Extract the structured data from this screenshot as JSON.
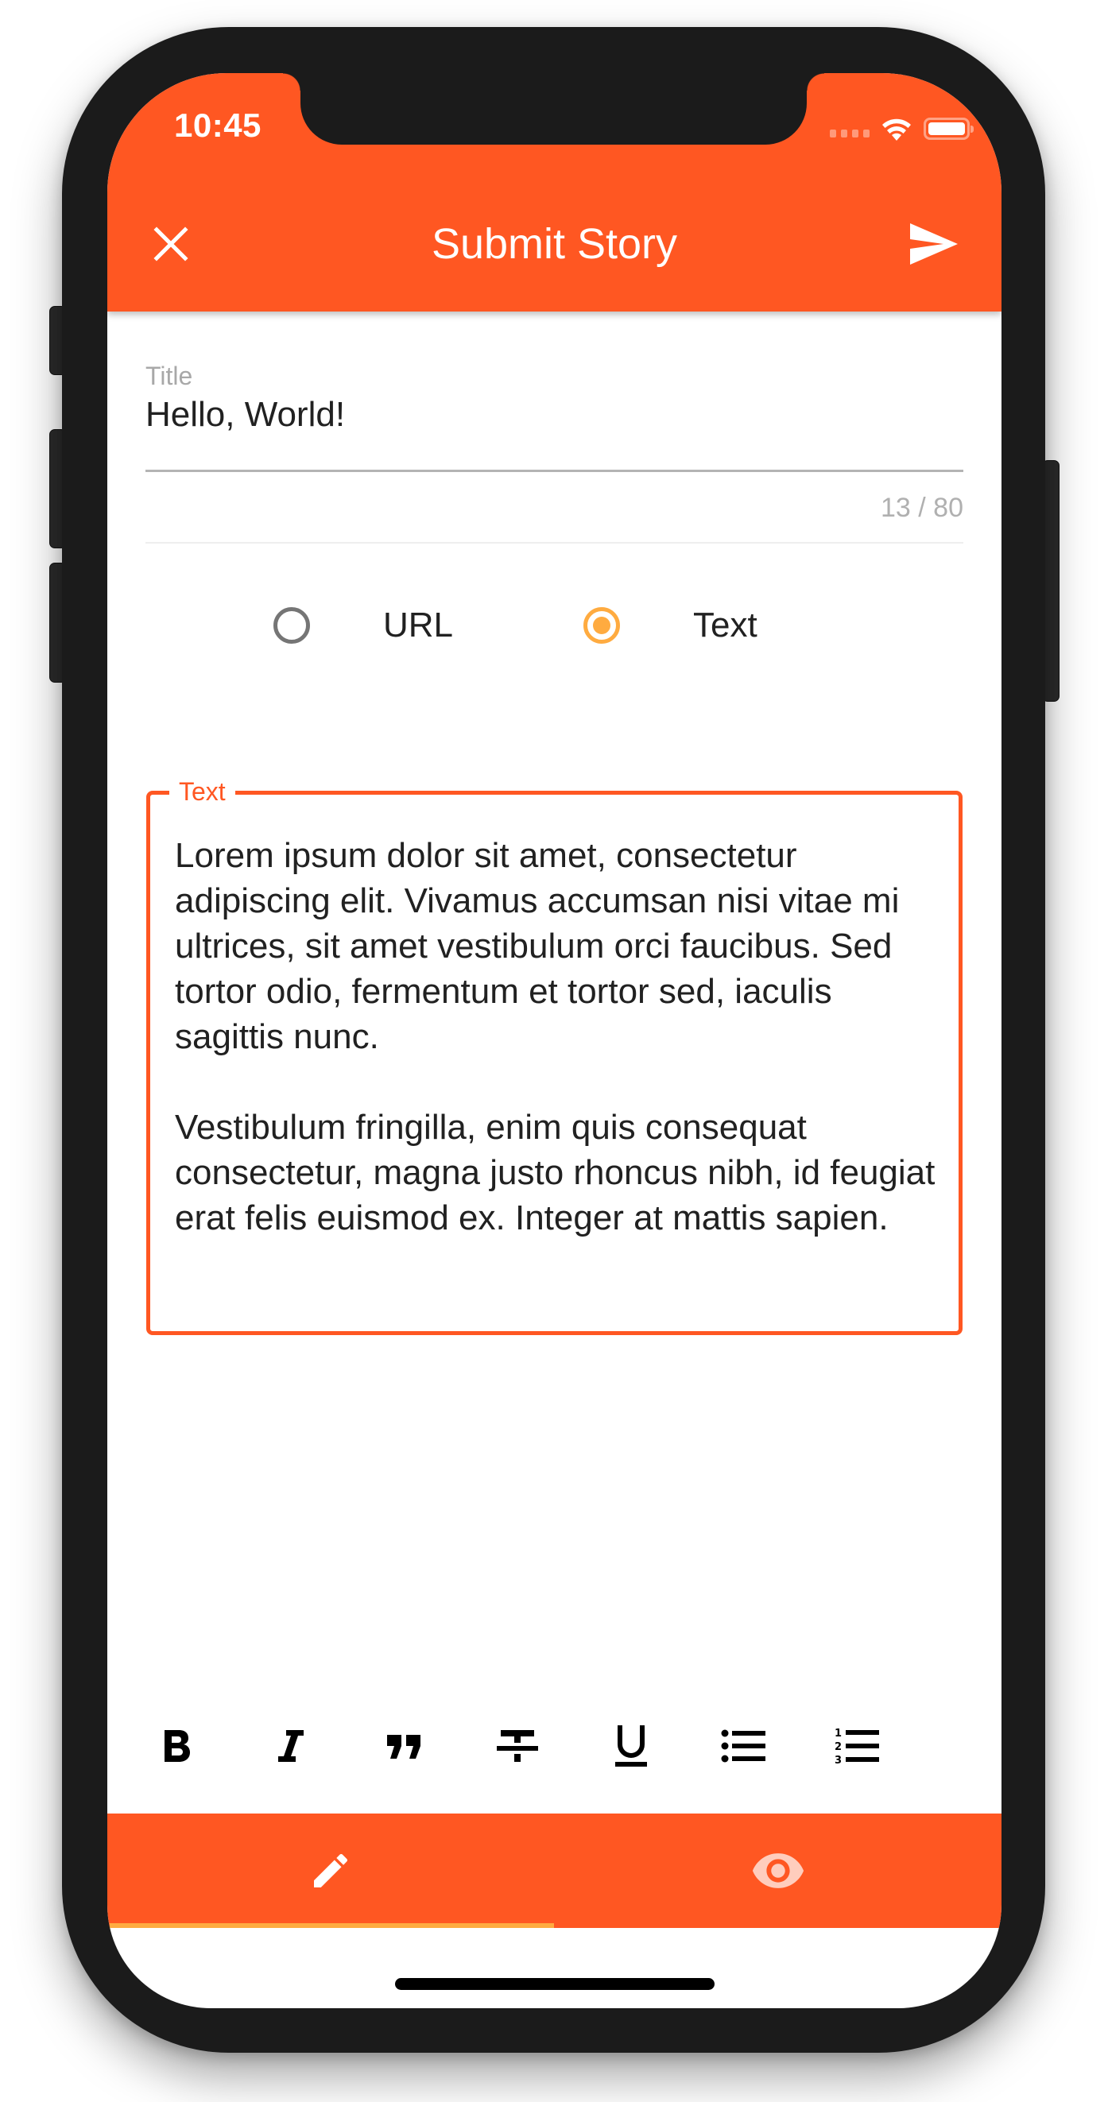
{
  "status_bar": {
    "time": "10:45",
    "icons": [
      "cellular-signal-icon",
      "wifi-icon",
      "battery-icon"
    ]
  },
  "app_bar": {
    "title": "Submit Story",
    "close_icon": "close-icon",
    "send_icon": "send-icon",
    "background": "#ff5722"
  },
  "form": {
    "title_field": {
      "label": "Title",
      "value": "Hello, World!",
      "counter": "13 / 80",
      "max_length": 80,
      "current_length": 13
    },
    "type_options": [
      {
        "label": "URL",
        "checked": false
      },
      {
        "label": "Text",
        "checked": true
      }
    ],
    "text_field": {
      "label": "Text",
      "value": "Lorem ipsum dolor sit amet, consectetur adipiscing elit. Vivamus accumsan nisi vitae mi ultrices, sit amet vestibulum orci faucibus. Sed tortor odio, fermentum et tortor sed, iaculis sagittis nunc.\n\nVestibulum fringilla, enim quis consequat consectetur, magna justo rhoncus nibh, id feugiat erat felis euismod ex. Integer at mattis sapien."
    }
  },
  "format_toolbar": [
    {
      "name": "bold",
      "icon": "bold-icon"
    },
    {
      "name": "italic",
      "icon": "italic-icon"
    },
    {
      "name": "quote",
      "icon": "quote-icon"
    },
    {
      "name": "strikethrough",
      "icon": "strikethrough-icon"
    },
    {
      "name": "underline",
      "icon": "underline-icon"
    },
    {
      "name": "bulleted-list",
      "icon": "bulleted-list-icon"
    },
    {
      "name": "numbered-list",
      "icon": "numbered-list-icon"
    }
  ],
  "bottom_nav": {
    "tabs": [
      {
        "name": "edit",
        "icon": "pencil-icon",
        "active": true
      },
      {
        "name": "preview",
        "icon": "eye-icon",
        "active": false
      }
    ]
  },
  "colors": {
    "primary": "#ff5722",
    "accent": "#ffab40",
    "text": "#212121",
    "hint": "#a8a8a8"
  }
}
